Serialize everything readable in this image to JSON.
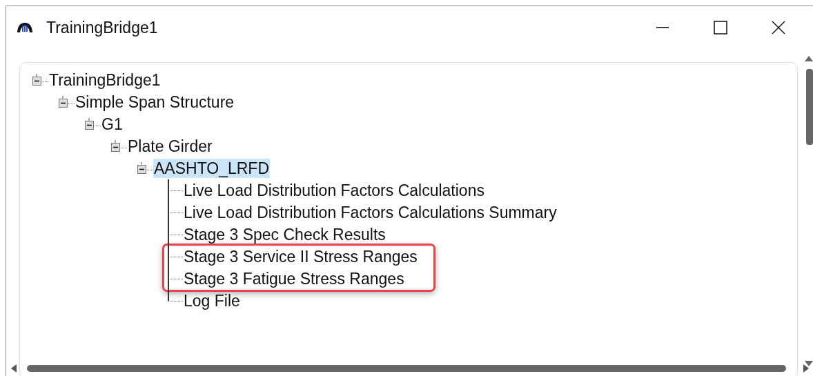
{
  "window": {
    "title": "TrainingBridge1"
  },
  "tree": [
    {
      "label": "TrainingBridge1",
      "expanded": true,
      "selected": false,
      "children": [
        {
          "label": "Simple Span Structure",
          "expanded": true,
          "selected": false,
          "children": [
            {
              "label": "G1",
              "expanded": true,
              "selected": false,
              "children": [
                {
                  "label": "Plate Girder",
                  "expanded": true,
                  "selected": false,
                  "children": [
                    {
                      "label": "AASHTO_LRFD",
                      "expanded": true,
                      "selected": true,
                      "children": [
                        {
                          "label": "Live Load Distribution Factors Calculations",
                          "selected": false,
                          "highlighted": false
                        },
                        {
                          "label": "Live Load Distribution Factors Calculations Summary",
                          "selected": false,
                          "highlighted": false
                        },
                        {
                          "label": "Stage 3 Spec Check Results",
                          "selected": false,
                          "highlighted": false
                        },
                        {
                          "label": "Stage 3 Service II Stress Ranges",
                          "selected": false,
                          "highlighted": true
                        },
                        {
                          "label": "Stage 3 Fatigue Stress Ranges",
                          "selected": false,
                          "highlighted": true
                        },
                        {
                          "label": "Log File",
                          "selected": false,
                          "highlighted": false
                        }
                      ]
                    }
                  ]
                }
              ]
            }
          ]
        }
      ]
    }
  ]
}
